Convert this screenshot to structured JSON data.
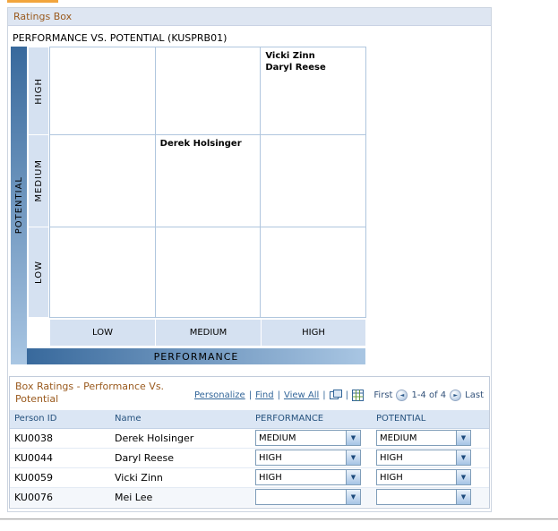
{
  "page": {
    "section_header": "Ratings Box",
    "chart_title": "PERFORMANCE VS. POTENTIAL (KUSPRB01)"
  },
  "matrix": {
    "y_axis": "POTENTIAL",
    "x_axis": "PERFORMANCE",
    "row_labels": [
      "HIGH",
      "MEDIUM",
      "LOW"
    ],
    "col_labels": [
      "LOW",
      "MEDIUM",
      "HIGH"
    ],
    "cells": {
      "high_high": [
        "Vicki Zinn",
        "Daryl Reese"
      ],
      "medium_medium": [
        "Derek Holsinger"
      ]
    }
  },
  "grid": {
    "title": "Box Ratings - Performance Vs. Potential",
    "toolbar": {
      "personalize": "Personalize",
      "find": "Find",
      "view_all": "View All",
      "separator": "|",
      "first": "First",
      "range": "1-4 of 4",
      "last": "Last"
    },
    "columns": {
      "person_id": "Person ID",
      "name": "Name",
      "performance": "PERFORMANCE",
      "potential": "POTENTIAL"
    },
    "rows": [
      {
        "person_id": "KU0038",
        "name": "Derek Holsinger",
        "performance": "MEDIUM",
        "potential": "MEDIUM"
      },
      {
        "person_id": "KU0044",
        "name": "Daryl Reese",
        "performance": "HIGH",
        "potential": "HIGH"
      },
      {
        "person_id": "KU0059",
        "name": "Vicki Zinn",
        "performance": "HIGH",
        "potential": "HIGH"
      },
      {
        "person_id": "KU0076",
        "name": "Mei Lee",
        "performance": "",
        "potential": ""
      }
    ]
  },
  "icons": {
    "dropdown_arrow": "▼",
    "previous_arrow": "◄",
    "next_arrow": "►"
  },
  "colors": {
    "section_header_text": "#9a5a1e",
    "section_header_bg": "#dee6f2",
    "axis_dark": "#38699c",
    "axis_light": "#a9c6e3",
    "matrix_label_bg": "#d5e1f1",
    "link": "#336699",
    "table_header_bg": "#dbe6f4",
    "table_header_text": "#26527e",
    "tab_edge": "#f2a53d"
  }
}
